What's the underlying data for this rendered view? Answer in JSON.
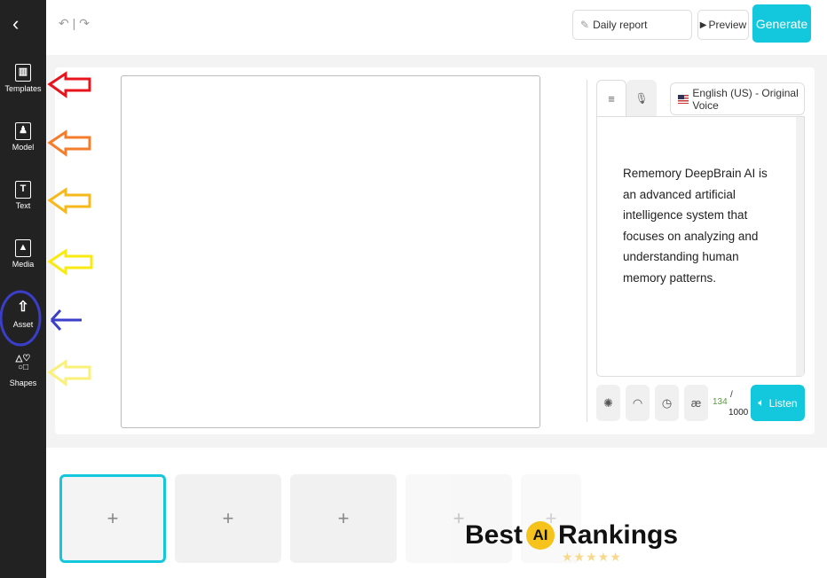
{
  "sidebar": {
    "items": [
      {
        "label": "Templates",
        "icon": "templates-icon"
      },
      {
        "label": "Model",
        "icon": "person-icon"
      },
      {
        "label": "Text",
        "icon": "text-icon"
      },
      {
        "label": "Media",
        "icon": "image-icon"
      },
      {
        "label": "Asset",
        "icon": "cloud-upload-icon"
      },
      {
        "label": "Shapes",
        "icon": "shapes-icon"
      }
    ]
  },
  "header": {
    "back": "‹",
    "undo": "↶ | ↷",
    "title_value": "Daily report",
    "preview": "Preview",
    "generate": "Generate"
  },
  "editor": {
    "language": "English (US) - Original Voice",
    "script": "Rememory DeepBrain AI is an advanced artificial intelligence system that focuses on analyzing and understanding human memory patterns.",
    "char_count": "134",
    "char_max": "1000",
    "listen": "Listen",
    "tabs": [
      "≡",
      "🎙"
    ],
    "tools": [
      "✺",
      "◠",
      "◷",
      "æ"
    ]
  },
  "scenes": {
    "add": "+",
    "count": 5
  },
  "watermark": {
    "text_left": "Best",
    "text_badge": "AI",
    "text_right": "Rankings",
    "stars": "★★★★★"
  },
  "annotations": {
    "arrow_colors": [
      "#e8141c",
      "#f57c2a",
      "#f7b919",
      "#f9ea10",
      "#3a3ec9",
      "#faf07a"
    ],
    "circle_color": "#3a3ec9"
  },
  "colors": {
    "accent": "#13c8dc",
    "sidebar": "#222222"
  }
}
